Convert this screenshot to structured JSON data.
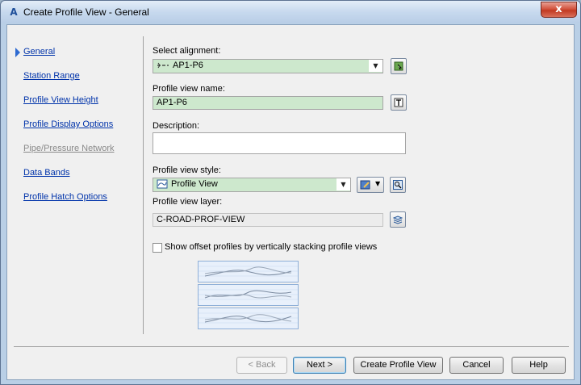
{
  "window": {
    "title": "Create Profile View - General",
    "close_label": "x"
  },
  "nav": {
    "items": [
      {
        "label": "General",
        "active": true,
        "enabled": true
      },
      {
        "label": "Station Range",
        "enabled": true
      },
      {
        "label": "Profile View Height",
        "enabled": true
      },
      {
        "label": "Profile Display Options",
        "enabled": true
      },
      {
        "label": "Pipe/Pressure Network",
        "enabled": false
      },
      {
        "label": "Data Bands",
        "enabled": true
      },
      {
        "label": "Profile Hatch Options",
        "enabled": true
      }
    ]
  },
  "form": {
    "alignment": {
      "label": "Select alignment:",
      "value": "AP1-P6"
    },
    "view_name": {
      "label": "Profile view name:",
      "value": "AP1-P6"
    },
    "description": {
      "label": "Description:",
      "value": ""
    },
    "style": {
      "label": "Profile view style:",
      "value": "Profile View"
    },
    "layer": {
      "label": "Profile view layer:",
      "value": "C-ROAD-PROF-VIEW"
    },
    "stack": {
      "label": "Show offset profiles by vertically stacking profile views",
      "checked": false
    }
  },
  "buttons": {
    "back": "< Back",
    "next": "Next >",
    "create": "Create Profile View",
    "cancel": "Cancel",
    "help": "Help"
  },
  "colors": {
    "accent": "#2e6bd1",
    "link": "#0033aa",
    "green_field": "#cde8cd"
  }
}
